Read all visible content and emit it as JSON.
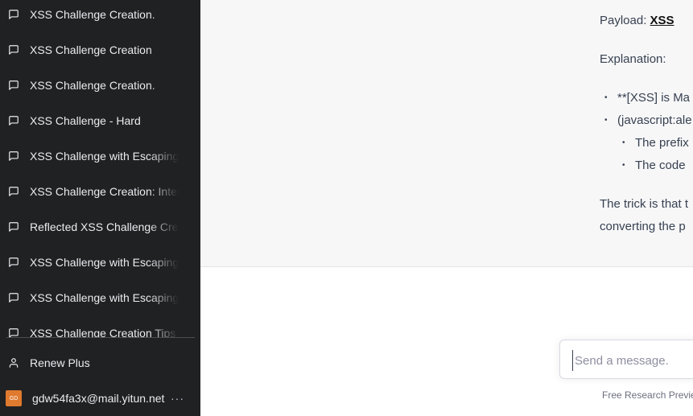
{
  "sidebar": {
    "conversations": [
      {
        "label": "XSS Challenge Creation."
      },
      {
        "label": "XSS Challenge Creation"
      },
      {
        "label": "XSS Challenge Creation."
      },
      {
        "label": "XSS Challenge - Hard"
      },
      {
        "label": "XSS Challenge with Escaping"
      },
      {
        "label": "XSS Challenge Creation: Inter"
      },
      {
        "label": "Reflected XSS Challenge Creat"
      },
      {
        "label": "XSS Challenge with Escaping"
      },
      {
        "label": "XSS Challenge with Escaping"
      },
      {
        "label": "XSS Challenge Creation Tips"
      }
    ],
    "renew_label": "Renew Plus",
    "user_email": "gdw54fa3x@mail.yitun.net",
    "avatar_initials": "GD",
    "more_label": "···"
  },
  "message": {
    "payload_label": "Payload:",
    "payload_value": "XSS",
    "explanation_label": "Explanation:",
    "bullet_1": "**[XSS] is Ma",
    "bullet_2": "(javascript:ale",
    "sub_bullet_1": "The prefix",
    "sub_bullet_2": "The code",
    "trick_line_1": "The trick is that t",
    "trick_line_2": "converting the p"
  },
  "composer": {
    "placeholder": "Send a message.",
    "footer_note": "Free Research Preview"
  },
  "colors": {
    "sidebar_bg": "#202123",
    "message_bg": "#f7f7f8",
    "avatar_bg": "#e07a2e"
  }
}
